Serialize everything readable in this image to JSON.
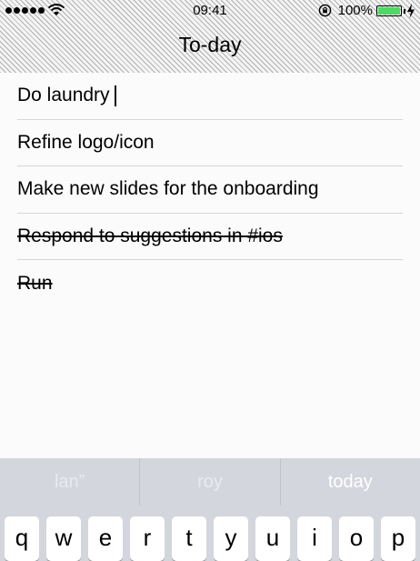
{
  "status_bar": {
    "time": "09:41",
    "battery_percent": "100%",
    "battery_level": 1.0,
    "battery_color": "#4cd964",
    "icons": [
      "signal-dots-icon",
      "wifi-icon",
      "orientation-lock-icon",
      "battery-icon",
      "charging-bolt-icon"
    ]
  },
  "header": {
    "title": "To-day"
  },
  "tasks": [
    {
      "text": "Do laundry",
      "completed": false,
      "editing": true
    },
    {
      "text": "Refine logo/icon",
      "completed": false
    },
    {
      "text": "Make new slides for the onboarding",
      "completed": false
    },
    {
      "text": "Respond to suggestions in #ios",
      "completed": true
    },
    {
      "text": "Run",
      "completed": true
    }
  ],
  "keyboard": {
    "predictions": [
      "lan”",
      "roy",
      "today"
    ],
    "keys": [
      "q",
      "w",
      "e",
      "r",
      "t",
      "y",
      "u",
      "i",
      "o",
      "p"
    ]
  }
}
